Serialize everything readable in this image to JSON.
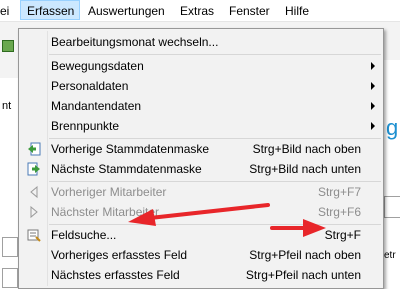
{
  "menubar": {
    "items": [
      {
        "label": "Datei"
      },
      {
        "label": "Erfassen"
      },
      {
        "label": "Auswertungen"
      },
      {
        "label": "Extras"
      },
      {
        "label": "Fenster"
      },
      {
        "label": "Hilfe"
      }
    ],
    "partial_left": "ei"
  },
  "background": {
    "left_text": "nt",
    "right_letter": "g",
    "right_text": "etr"
  },
  "menu": {
    "items": [
      {
        "label": "Bearbeitungsmonat wechseln...",
        "shortcut": ""
      },
      {
        "label": "Bewegungsdaten",
        "shortcut": ""
      },
      {
        "label": "Personaldaten",
        "shortcut": ""
      },
      {
        "label": "Mandantendaten",
        "shortcut": ""
      },
      {
        "label": "Brennpunkte",
        "shortcut": ""
      },
      {
        "label": "Vorherige Stammdatenmaske",
        "shortcut": "Strg+Bild nach oben"
      },
      {
        "label": "Nächste Stammdatenmaske",
        "shortcut": "Strg+Bild nach unten"
      },
      {
        "label": "Vorheriger Mitarbeiter",
        "shortcut": "Strg+F7"
      },
      {
        "label": "Nächster Mitarbeiter",
        "shortcut": "Strg+F6"
      },
      {
        "label": "Feldsuche...",
        "shortcut": "Strg+F"
      },
      {
        "label": "Vorheriges erfasstes Feld",
        "shortcut": "Strg+Pfeil nach oben"
      },
      {
        "label": "Nächstes erfasstes Feld",
        "shortcut": "Strg+Pfeil nach unten"
      }
    ]
  },
  "colors": {
    "active_menu_bg": "#cce8ff",
    "annotation_arrow": "#e8262a",
    "disabled_text": "#8d8d8d"
  }
}
